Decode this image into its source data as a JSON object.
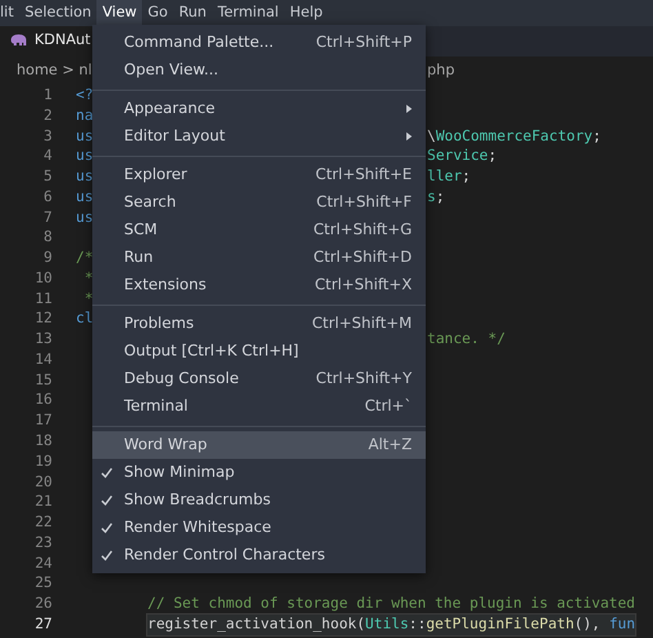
{
  "menu_bar": [
    {
      "label": "lit",
      "selected": false
    },
    {
      "label": "Selection",
      "selected": false
    },
    {
      "label": "View",
      "selected": true
    },
    {
      "label": "Go",
      "selected": false
    },
    {
      "label": "Run",
      "selected": false
    },
    {
      "label": "Terminal",
      "selected": false
    },
    {
      "label": "Help",
      "selected": false
    }
  ],
  "tab": {
    "label": "KDNAut"
  },
  "breadcrumbs": {
    "left": "home > nl",
    "right": "php"
  },
  "code_lines": [
    {
      "number": "1",
      "current": false,
      "left": [
        {
          "text": "<?",
          "kind": "keyword"
        }
      ]
    },
    {
      "number": "2",
      "current": false,
      "left": [
        {
          "text": "na",
          "kind": "keyword"
        }
      ]
    },
    {
      "number": "3",
      "current": false,
      "left": [
        {
          "text": "us",
          "kind": "keyword"
        }
      ],
      "right": [
        {
          "text": "\\",
          "kind": "plain"
        },
        {
          "text": "WooCommerceFactory",
          "kind": "class"
        },
        {
          "text": ";",
          "kind": "plain"
        }
      ]
    },
    {
      "number": "4",
      "current": false,
      "left": [
        {
          "text": "us",
          "kind": "keyword"
        }
      ],
      "right": [
        {
          "text": "Service",
          "kind": "class"
        },
        {
          "text": ";",
          "kind": "plain"
        }
      ]
    },
    {
      "number": "5",
      "current": false,
      "left": [
        {
          "text": "us",
          "kind": "keyword"
        }
      ],
      "right": [
        {
          "text": "ller",
          "kind": "class"
        },
        {
          "text": ";",
          "kind": "plain"
        }
      ]
    },
    {
      "number": "6",
      "current": false,
      "left": [
        {
          "text": "us",
          "kind": "keyword"
        }
      ],
      "right": [
        {
          "text": "s",
          "kind": "class"
        },
        {
          "text": ";",
          "kind": "plain"
        }
      ]
    },
    {
      "number": "7",
      "current": false,
      "left": [
        {
          "text": "us",
          "kind": "keyword"
        }
      ]
    },
    {
      "number": "8",
      "current": false
    },
    {
      "number": "9",
      "current": false,
      "left": [
        {
          "text": "/*",
          "kind": "comment"
        }
      ]
    },
    {
      "number": "10",
      "current": false,
      "left": [
        {
          "text": " *",
          "kind": "comment"
        }
      ]
    },
    {
      "number": "11",
      "current": false,
      "left": [
        {
          "text": " *",
          "kind": "comment"
        }
      ]
    },
    {
      "number": "12",
      "current": false,
      "left": [
        {
          "text": "cl",
          "kind": "keyword"
        }
      ]
    },
    {
      "number": "13",
      "current": false,
      "right": [
        {
          "text": "tance. */",
          "kind": "comment"
        }
      ]
    },
    {
      "number": "14",
      "current": false
    },
    {
      "number": "15",
      "current": false
    },
    {
      "number": "16",
      "current": false
    },
    {
      "number": "17",
      "current": false
    },
    {
      "number": "18",
      "current": false
    },
    {
      "number": "19",
      "current": false
    },
    {
      "number": "20",
      "current": false
    },
    {
      "number": "21",
      "current": false
    },
    {
      "number": "22",
      "current": false
    },
    {
      "number": "23",
      "current": false
    },
    {
      "number": "24",
      "current": false
    },
    {
      "number": "25",
      "current": false
    },
    {
      "number": "26",
      "current": false,
      "full": [
        {
          "text": "// Set chmod of storage dir when the plugin is activated",
          "kind": "comment"
        }
      ]
    },
    {
      "number": "27",
      "current": true,
      "full": [
        {
          "text": "register_activation_hook",
          "kind": "plain"
        },
        {
          "text": "(",
          "kind": "plain"
        },
        {
          "text": "Utils",
          "kind": "class"
        },
        {
          "text": "::",
          "kind": "plain"
        },
        {
          "text": "getPluginFilePath",
          "kind": "function"
        },
        {
          "text": "(), ",
          "kind": "plain"
        },
        {
          "text": "fun",
          "kind": "keyword"
        }
      ]
    }
  ],
  "view_menu": {
    "groups": [
      [
        {
          "label": "Command Palette...",
          "shortcut": "Ctrl+Shift+P"
        },
        {
          "label": "Open View..."
        }
      ],
      [
        {
          "label": "Appearance",
          "submenu": true
        },
        {
          "label": "Editor Layout",
          "submenu": true
        }
      ],
      [
        {
          "label": "Explorer",
          "shortcut": "Ctrl+Shift+E"
        },
        {
          "label": "Search",
          "shortcut": "Ctrl+Shift+F"
        },
        {
          "label": "SCM",
          "shortcut": "Ctrl+Shift+G"
        },
        {
          "label": "Run",
          "shortcut": "Ctrl+Shift+D"
        },
        {
          "label": "Extensions",
          "shortcut": "Ctrl+Shift+X"
        }
      ],
      [
        {
          "label": "Problems",
          "shortcut": "Ctrl+Shift+M"
        },
        {
          "label": "Output [Ctrl+K Ctrl+H]"
        },
        {
          "label": "Debug Console",
          "shortcut": "Ctrl+Shift+Y"
        },
        {
          "label": "Terminal",
          "shortcut": "Ctrl+`"
        }
      ],
      [
        {
          "label": "Word Wrap",
          "shortcut": "Alt+Z",
          "checked": false,
          "selected": true
        },
        {
          "label": "Show Minimap",
          "checked": true,
          "selected": false
        },
        {
          "label": "Show Breadcrumbs",
          "checked": true,
          "selected": false
        },
        {
          "label": "Render Whitespace",
          "checked": true,
          "selected": false
        },
        {
          "label": "Render Control Characters",
          "checked": true,
          "selected": false
        }
      ]
    ]
  }
}
